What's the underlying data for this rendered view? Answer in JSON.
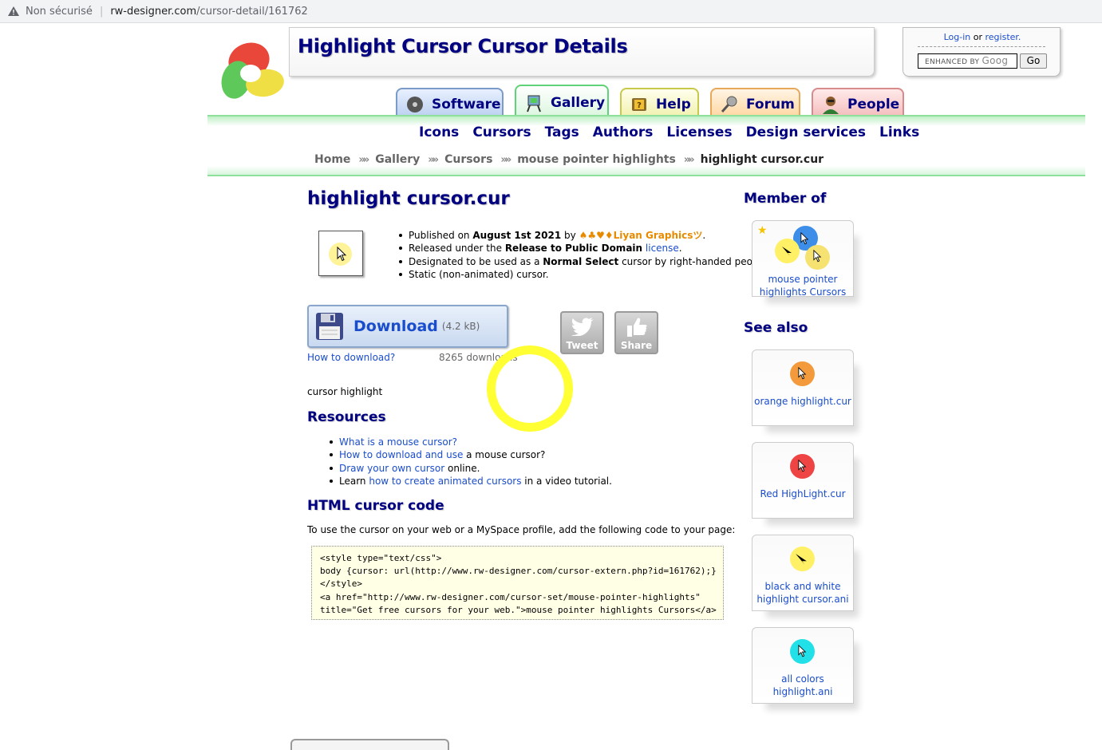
{
  "browser": {
    "security_label": "Non sécurisé",
    "url_host": "rw-designer.com",
    "url_path": "/cursor-detail/161762"
  },
  "header": {
    "title": "Highlight Cursor Cursor Details",
    "login": "Log-in",
    "or": "or",
    "register": "register.",
    "search_badge": "ENHANCED BY",
    "search_brand": "Goog",
    "go": "Go"
  },
  "tabs": [
    {
      "label": "Software"
    },
    {
      "label": "Gallery"
    },
    {
      "label": "Help"
    },
    {
      "label": "Forum"
    },
    {
      "label": "People"
    }
  ],
  "subnav": [
    "Icons",
    "Cursors",
    "Tags",
    "Authors",
    "Licenses",
    "Design services",
    "Links"
  ],
  "breadcrumb": [
    "Home",
    "Gallery",
    "Cursors",
    "mouse pointer highlights",
    "highlight cursor.cur"
  ],
  "main": {
    "heading": "highlight cursor.cur",
    "facts": {
      "published_prefix": "Published on",
      "published_date": "August 1st 2021",
      "by": "by",
      "author": "♠♣♥♦Liyan Graphicsツ",
      "released_prefix": "Released under the",
      "license_name": "Release to Public Domain",
      "license_link": "license",
      "designated_prefix": "Designated to be used as a",
      "cursor_role": "Normal Select",
      "designated_suffix": "cursor by right-handed people.",
      "static": "Static (non-animated) cursor."
    },
    "download": {
      "label": "Download",
      "size": "(4.2 kB)",
      "how": "How to download?",
      "count": "8265 downloads"
    },
    "social": {
      "tweet": "Tweet",
      "share": "Share"
    },
    "tagline": "cursor highlight",
    "resources": {
      "heading": "Resources",
      "items": [
        {
          "link": "What is a mouse cursor?",
          "text": ""
        },
        {
          "link": "How to download and use",
          "text": " a mouse cursor?"
        },
        {
          "link": "Draw your own cursor",
          "text": " online."
        },
        {
          "pre": "Learn ",
          "link": "how to create animated cursors",
          "text": " in a video tutorial."
        }
      ]
    },
    "html_code": {
      "heading": "HTML cursor code",
      "intro": "To use the cursor on your web or a MySpace profile, add the following code to your page:",
      "code": "<style type=\"text/css\">\nbody {cursor: url(http://www.rw-designer.com/cursor-extern.php?id=161762);}\n</style>\n<a href=\"http://www.rw-designer.com/cursor-set/mouse-pointer-highlights\"\ntitle=\"Get free cursors for your web.\">mouse pointer highlights Cursors</a>"
    }
  },
  "sidebar": {
    "member_heading": "Member of",
    "member_card": {
      "line1": "mouse pointer",
      "line2": "highlights Cursors"
    },
    "see_also_heading": "See also",
    "see_also": [
      {
        "line1": "orange highlight.cur",
        "line2": "",
        "color": "#f39a3c"
      },
      {
        "line1": "Red HighLight.cur",
        "line2": "",
        "color": "#ef4444"
      },
      {
        "line1": "black and white",
        "line2": "highlight cursor.ani",
        "color": "#fff066"
      },
      {
        "line1": "all colors highlight.ani",
        "line2": "",
        "color": "#22e0e8"
      }
    ]
  }
}
